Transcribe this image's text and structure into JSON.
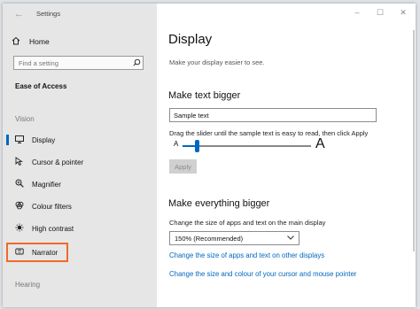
{
  "window": {
    "title": "Settings"
  },
  "controls": {
    "back": "←",
    "minimize": "–",
    "maximize": "☐",
    "close": "✕"
  },
  "sidebar": {
    "home_label": "Home",
    "search_placeholder": "Find a setting",
    "section_title": "Ease of Access",
    "group_vision": "Vision",
    "group_hearing": "Hearing",
    "items": [
      {
        "label": "Display",
        "icon": "monitor-icon"
      },
      {
        "label": "Cursor & pointer",
        "icon": "cursor-icon"
      },
      {
        "label": "Magnifier",
        "icon": "magnifier-icon"
      },
      {
        "label": "Colour filters",
        "icon": "color-filter-icon"
      },
      {
        "label": "High contrast",
        "icon": "high-contrast-icon"
      },
      {
        "label": "Narrator",
        "icon": "narrator-icon"
      }
    ]
  },
  "main": {
    "title": "Display",
    "subtitle": "Make your display easier to see.",
    "text_bigger": {
      "heading": "Make text bigger",
      "sample_value": "Sample text",
      "instructions": "Drag the slider until the sample text is easy to read, then click Apply",
      "small_a": "A",
      "big_a": "A",
      "slider_level": 0.11,
      "apply_label": "Apply"
    },
    "everything_bigger": {
      "heading": "Make everything bigger",
      "description": "Change the size of apps and text on the main display",
      "selected_scale": "150% (Recommended)",
      "link_other_displays": "Change the size of apps and text on other displays",
      "link_cursor": "Change the size and colour of your cursor and mouse pointer"
    }
  },
  "colors": {
    "accent": "#0067c0",
    "highlight": "#ee6a2c",
    "sidebar_bg": "#e6e6e6"
  }
}
